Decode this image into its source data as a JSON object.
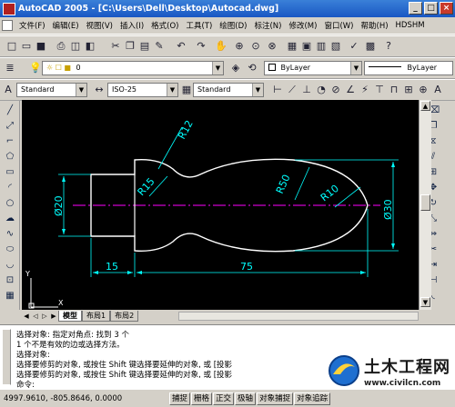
{
  "window": {
    "title": "AutoCAD 2005 - [C:\\Users\\Dell\\Desktop\\Autocad.dwg]",
    "controls": [
      "_",
      "□",
      "×"
    ]
  },
  "menu": [
    "文件(F)",
    "编辑(E)",
    "视图(V)",
    "插入(I)",
    "格式(O)",
    "工具(T)",
    "绘图(D)",
    "标注(N)",
    "修改(M)",
    "窗口(W)",
    "帮助(H)",
    "HDSHM"
  ],
  "layers": {
    "current_layer": "0",
    "color": "ByLayer",
    "linetype": "ByLayer"
  },
  "styles": {
    "text_style": "Standard",
    "dim_style": "ISO-25",
    "table_style": "Standard"
  },
  "drawing": {
    "radius_labels": [
      "R12",
      "R15",
      "R50",
      "R10"
    ],
    "diameter_labels": [
      "Ø20",
      "Ø30"
    ],
    "linear_labels": [
      "15",
      "75"
    ],
    "ucs_x": "X",
    "ucs_y": "Y",
    "colors": {
      "background": "#000000",
      "outline": "#ffffff",
      "dimension": "#00ffff",
      "centerline": "#ff00ff"
    }
  },
  "layout_tabs": [
    "模型",
    "布局1",
    "布局2"
  ],
  "command_lines": [
    "选择对象: 指定对角点: 找到 3 个",
    "1 个不是有效的边或选择方法。",
    "选择对象:",
    "选择要修剪的对象, 或按住 Shift 键选择要延伸的对象, 或 [投影",
    "选择要修剪的对象, 或按住 Shift 键选择要延伸的对象, 或 [投影",
    "命令:"
  ],
  "status": {
    "coordinates": "4997.9610, -805.8646, 0.0000",
    "toggles": [
      "捕捉",
      "栅格",
      "正交",
      "极轴",
      "对象捕捉",
      "对象追踪"
    ]
  },
  "watermark": {
    "title": "土木工程网",
    "url": "www.civilcn.com"
  }
}
